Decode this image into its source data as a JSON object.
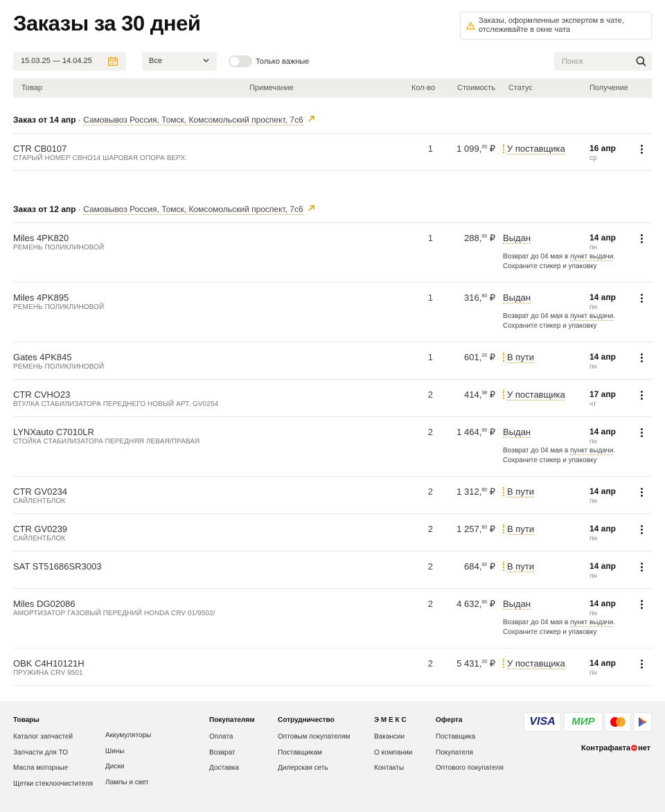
{
  "page": {
    "title_prefix": "Заказы за ",
    "title_days": "30 дней",
    "notice_line1": "Заказы, оформленные экспертом в чате,",
    "notice_line2": "отслеживайте в окне чата"
  },
  "filters": {
    "date_range": "15.03.25 — 14.04.25",
    "select_value": "Все",
    "toggle_label": "Только важные",
    "search_placeholder": "Поиск"
  },
  "columns": [
    "Товар",
    "Примечание",
    "Кол-во",
    "Стоимость",
    "Статус",
    "Получение"
  ],
  "groups": [
    {
      "heading": "Заказ от 14 апр",
      "sep": " · ",
      "address": "Самовывоз Россия, Томск, Комсомольский проспект, 7с6",
      "items": [
        {
          "name": "CTR CB0107",
          "note": "СТАРЫЙ НОМЕР CBHO14 ШАРОВАЯ ОПОРА ВЕРХ.",
          "qty": "1",
          "price": "1 099,",
          "cents": "20",
          "cur": " ₽",
          "status": "У поставщика",
          "date": "16 апр",
          "dow": "ср"
        }
      ]
    },
    {
      "heading": "Заказ от 12 апр",
      "sep": " · ",
      "address": "Самовывоз Россия, Томск, Комсомольский проспект, 7с6",
      "items": [
        {
          "name": "Miles 4PK820",
          "note": "РЕМЕНЬ ПОЛИКЛИНОВОЙ",
          "qty": "1",
          "price": "288,",
          "cents": "00",
          "cur": " ₽",
          "status": "Выдан",
          "date": "14 апр",
          "dow": "пн"
        },
        {
          "name": "Miles 4PK895",
          "note": "РЕМЕНЬ ПОЛИКЛИНОВОЙ",
          "qty": "1",
          "price": "316,",
          "cents": "80",
          "cur": " ₽",
          "status": "Выдан",
          "date": "14 апр",
          "dow": "пн"
        },
        {
          "name": "Gates 4PK845",
          "note": "РЕМЕНЬ ПОЛИКЛИНОВОЙ",
          "qty": "1",
          "price": "601,",
          "cents": "20",
          "cur": " ₽",
          "status": "В пути",
          "date": "14 апр",
          "dow": "пн"
        },
        {
          "name": "CTR CVHO23",
          "note": "ВТУЛКА СТАБИЛИЗАТОРА ПЕРЕДНЕГО НОВЫЙ АРТ. GV0254",
          "qty": "2",
          "price": "414,",
          "cents": "38",
          "cur": " ₽",
          "status": "У поставщика",
          "date": "17 апр",
          "dow": "чт"
        },
        {
          "name": "LYNXauto C7010LR",
          "note": "СТОЙКА СТАБИЛИЗАТОРА ПЕРЕДНЯЯ ЛЕВАЯ/ПРАВАЯ",
          "qty": "2",
          "price": "1 464,",
          "cents": "00",
          "cur": " ₽",
          "status": "Выдан",
          "date": "14 апр",
          "dow": "пн"
        },
        {
          "name": "CTR GV0234",
          "note": "САЙЛЕНТБЛОК",
          "qty": "2",
          "price": "1 312,",
          "cents": "80",
          "cur": " ₽",
          "status": "В пути",
          "date": "14 апр",
          "dow": "пн"
        },
        {
          "name": "CTR GV0239",
          "note": "САЙЛЕНТБЛОК",
          "qty": "2",
          "price": "1 257,",
          "cents": "60",
          "cur": " ₽",
          "status": "В пути",
          "date": "14 апр",
          "dow": "пн"
        },
        {
          "name": "SAT ST51686SR3003",
          "note": "",
          "qty": "2",
          "price": "684,",
          "cents": "00",
          "cur": " ₽",
          "status": "В пути",
          "date": "14 апр",
          "dow": "пн"
        },
        {
          "name": "Miles DG02086",
          "note": "АМОРТИЗАТОР ГАЗОВЫЙ ПЕРЕДНИЙ HONDA CRV 01/9502/",
          "qty": "2",
          "price": "4 632,",
          "cents": "00",
          "cur": " ₽",
          "status": "Выдан",
          "date": "14 апр",
          "dow": "пн"
        },
        {
          "name": "OBK C4H10121H",
          "note": "ПРУЖИНА CRV 9501",
          "qty": "2",
          "price": "5 431,",
          "cents": "20",
          "cur": " ₽",
          "status": "У поставщика",
          "date": "14 апр",
          "dow": "пн"
        }
      ]
    }
  ],
  "return_info": {
    "prefix": "Возврат до 04 мая в ",
    "link": "пункт выдачи",
    "suffix": ".",
    "line2": "Сохраните стикер и упаковку"
  },
  "footer": {
    "goods": {
      "heading": "Товары",
      "col1": [
        "Каталог запчастей",
        "Запчасти для ТО",
        "Масла моторные",
        "Щетки стеклоочистителя"
      ],
      "col2": [
        "Аккумуляторы",
        "Шины",
        "Диски",
        "Лампы и свет"
      ]
    },
    "buyers": {
      "heading": "Покупателям",
      "items": [
        "Оплата",
        "Возврат",
        "Доставка"
      ]
    },
    "coop": {
      "heading": "Сотрудничество",
      "items": [
        "Оптовым покупателям",
        "Поставщикам",
        "Дилерская сеть"
      ]
    },
    "emex": {
      "heading": "Э М Е К С",
      "items": [
        "Вакансии",
        "О компании",
        "Контакты"
      ]
    },
    "offer": {
      "heading": "Оферта",
      "items": [
        "Поставщика",
        "Покупателя",
        "Оптового покупателя"
      ]
    },
    "payments": {
      "visa": "VISA",
      "mir": "МИР"
    },
    "kontrafakta": {
      "left": "Контрафакта",
      "right": "нет"
    }
  },
  "colors": {
    "accent": "#f0a500",
    "header_bg": "#eeede9",
    "footer_bg": "#f2f2f2",
    "mir_green": "#3bb54a",
    "visa_blue": "#1a1f71"
  }
}
